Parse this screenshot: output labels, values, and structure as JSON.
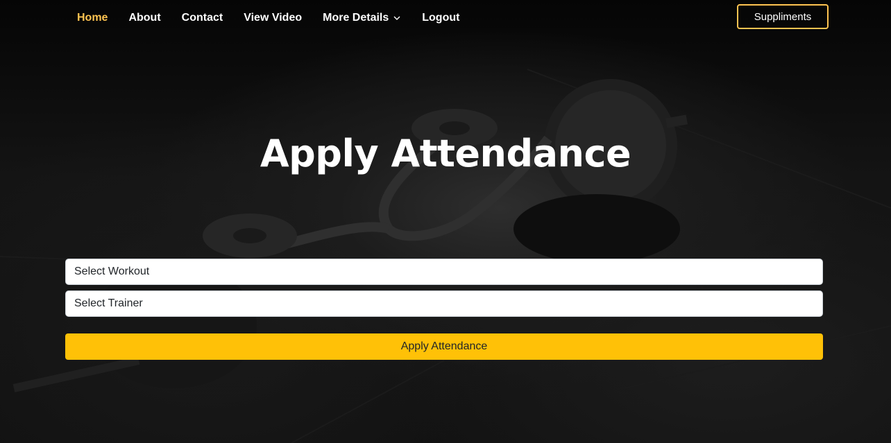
{
  "nav": {
    "items": [
      {
        "label": "Home",
        "active": true
      },
      {
        "label": "About",
        "active": false
      },
      {
        "label": "Contact",
        "active": false
      },
      {
        "label": "View Video",
        "active": false
      },
      {
        "label": "More Details",
        "active": false,
        "dropdown": true
      },
      {
        "label": "Logout",
        "active": false
      }
    ],
    "cta_label": "Suppliments"
  },
  "hero": {
    "title": "Apply Attendance"
  },
  "form": {
    "workout_select": "Select Workout",
    "trainer_select": "Select Trainer",
    "submit_label": "Apply Attendance"
  },
  "colors": {
    "accent": "#ffc451",
    "button": "#ffc107",
    "background": "#121212"
  }
}
